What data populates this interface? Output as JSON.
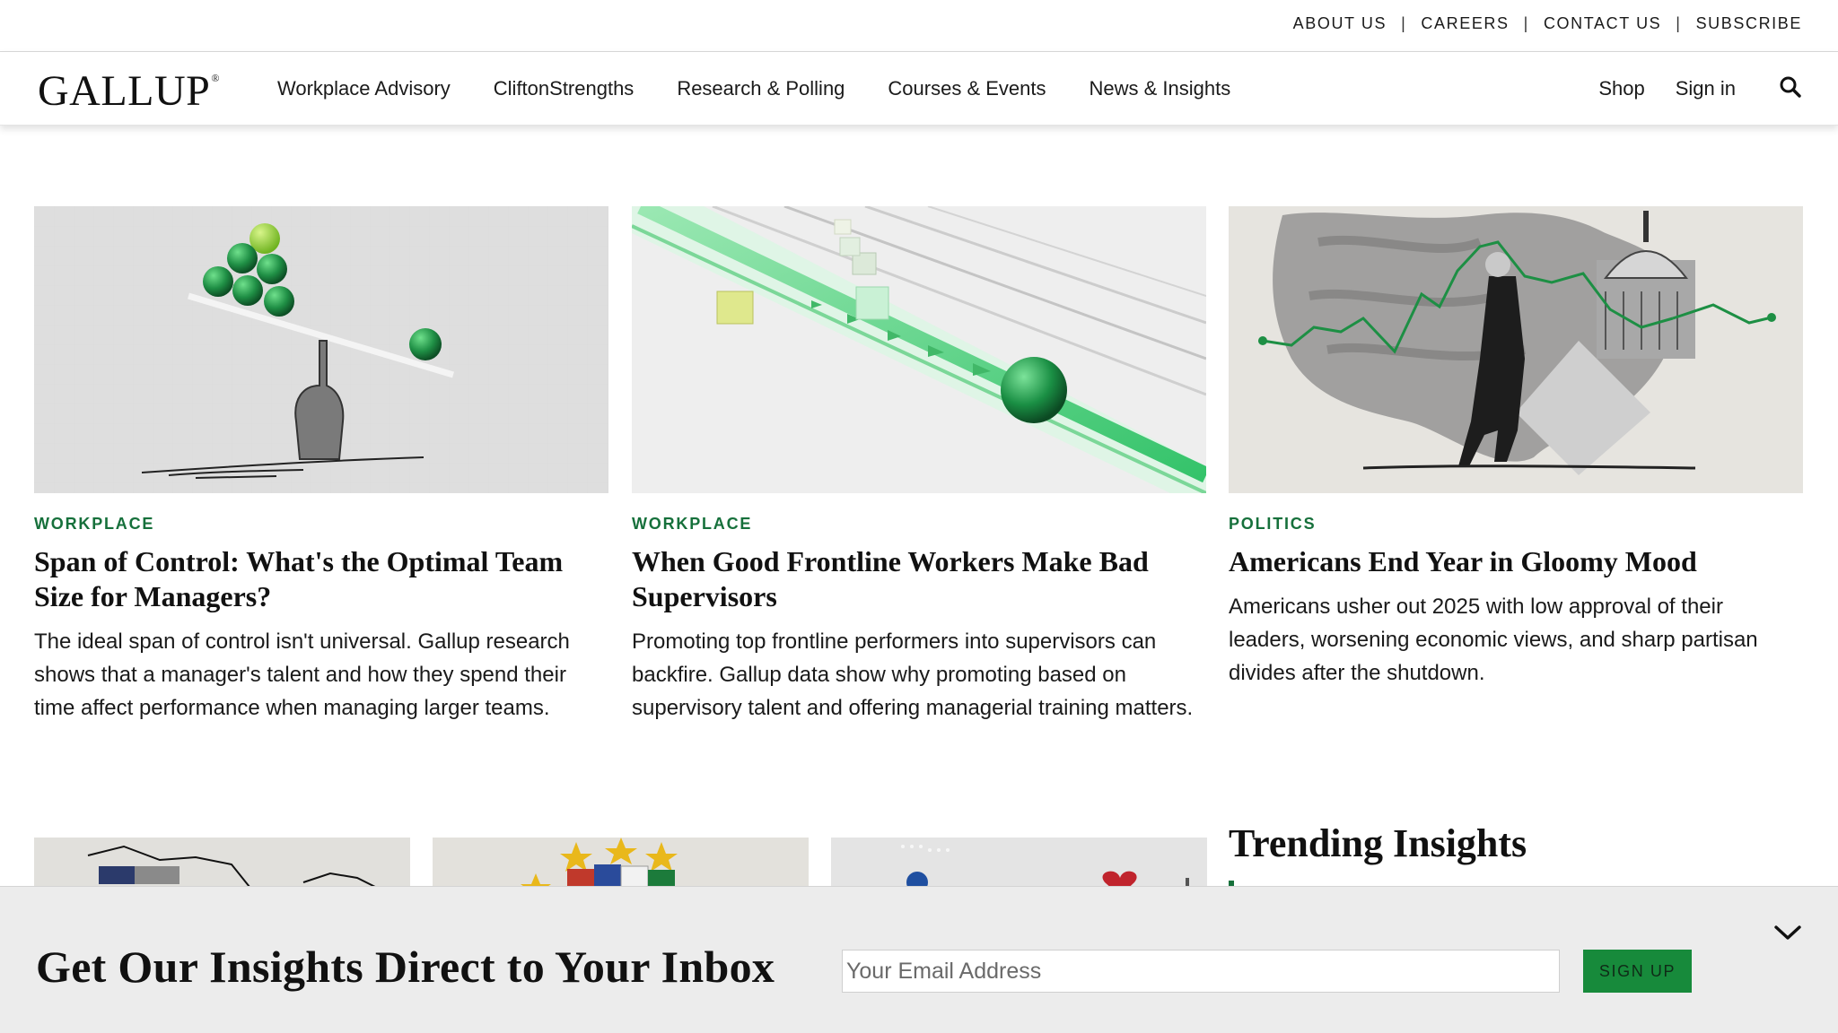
{
  "utility_nav": [
    "ABOUT US",
    "CAREERS",
    "CONTACT US",
    "SUBSCRIBE"
  ],
  "brand": {
    "logo": "GALLUP",
    "mark": "®"
  },
  "main_nav": [
    "Workplace Advisory",
    "CliftonStrengths",
    "Research & Polling",
    "Courses & Events",
    "News & Insights"
  ],
  "nav_right": {
    "shop": "Shop",
    "sign_in": "Sign in",
    "search_icon": "search-icon"
  },
  "articles": [
    {
      "category": "WORKPLACE",
      "title": "Span of Control: What's the Optimal Team Size for Managers?",
      "summary": "The ideal span of control isn't universal. Gallup research shows that a manager's talent and how they spend their time affect performance when managing larger teams."
    },
    {
      "category": "WORKPLACE",
      "title": "When Good Frontline Workers Make Bad Supervisors",
      "summary": "Promoting top frontline performers into supervisors can backfire. Gallup data show why promoting based on supervisory talent and offering managerial training matters."
    },
    {
      "category": "POLITICS",
      "title": "Americans End Year in Gloomy Mood",
      "summary": "Americans usher out 2025 with low approval of their leaders, worsening economic views, and sharp partisan divides after the shutdown."
    }
  ],
  "trending": {
    "heading": "Trending Insights"
  },
  "newsletter": {
    "heading": "Get Our Insights Direct to Your Inbox",
    "placeholder": "Your Email Address",
    "button": "SIGN UP",
    "collapse_icon": "chevron-down-icon"
  },
  "colors": {
    "accent_green": "#16703b",
    "button_green": "#178a3b",
    "banner_bg": "#ececec"
  }
}
